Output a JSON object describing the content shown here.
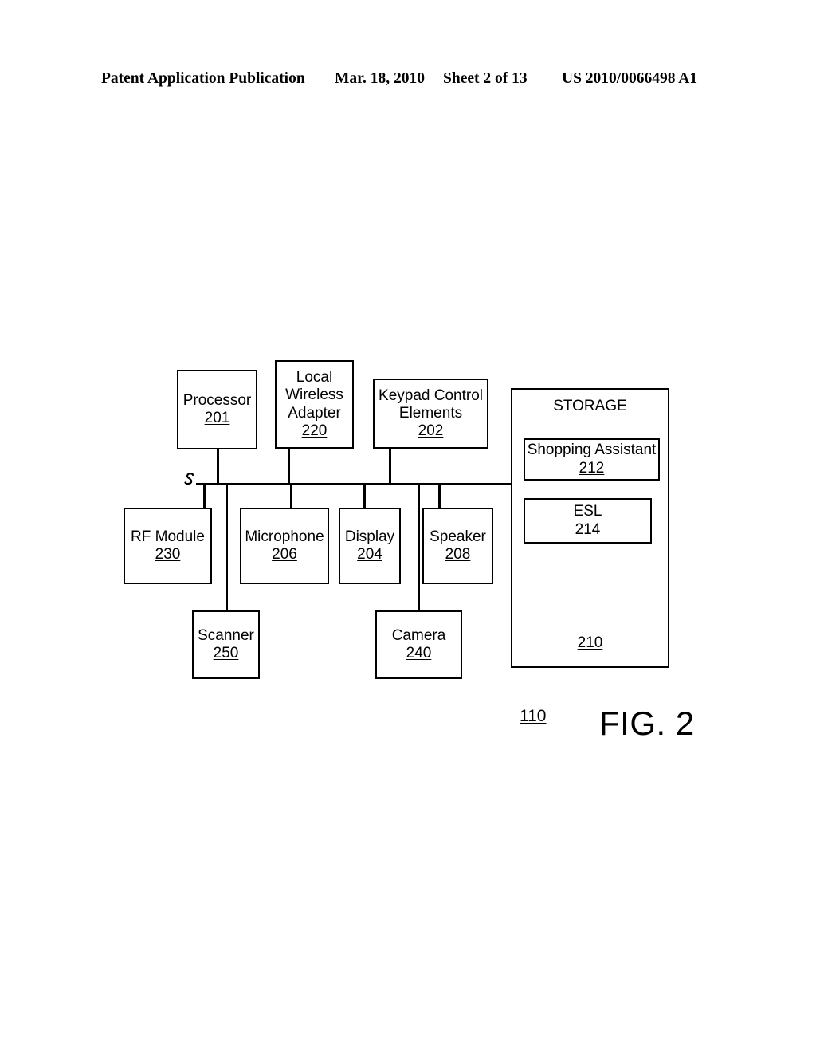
{
  "header": {
    "publication": "Patent Application Publication",
    "date": "Mar. 18, 2010",
    "sheet": "Sheet 2 of 13",
    "patent_number": "US 2010/0066498 A1"
  },
  "figure": {
    "caption": "FIG. 2",
    "device_ref": "110",
    "boxes": {
      "processor": {
        "label": "Processor",
        "ref": "201"
      },
      "wireless_adapter": {
        "label": "Local\nWireless\nAdapter",
        "ref": "220"
      },
      "keypad": {
        "label": "Keypad Control\nElements",
        "ref": "202"
      },
      "rf_module": {
        "label": "RF Module",
        "ref": "230"
      },
      "microphone": {
        "label": "Microphone",
        "ref": "206"
      },
      "display": {
        "label": "Display",
        "ref": "204"
      },
      "speaker": {
        "label": "Speaker",
        "ref": "208"
      },
      "scanner": {
        "label": "Scanner",
        "ref": "250"
      },
      "camera": {
        "label": "Camera",
        "ref": "240"
      }
    },
    "storage": {
      "title": "STORAGE",
      "ref": "210",
      "modules": {
        "shopping_assistant": {
          "label": "Shopping Assistant",
          "ref": "212"
        },
        "esl": {
          "label": "ESL",
          "ref": "214"
        }
      }
    }
  },
  "colors": {
    "ink": "#000000",
    "paper": "#ffffff"
  }
}
